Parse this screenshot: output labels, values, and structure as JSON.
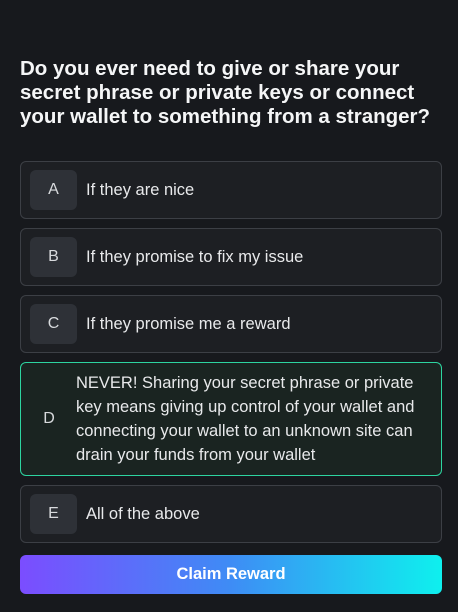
{
  "question": "Do you ever need to give or share your secret phrase or private keys or connect your wallet to something from a stranger?",
  "options": [
    {
      "letter": "A",
      "text": "If they are nice"
    },
    {
      "letter": "B",
      "text": "If they promise to fix my issue"
    },
    {
      "letter": "C",
      "text": "If they promise me a reward"
    },
    {
      "letter": "D",
      "text": "NEVER! Sharing your secret phrase or private key means giving up control of your wallet and connecting your wallet to an unknown site can drain your funds from your wallet"
    },
    {
      "letter": "E",
      "text": "All of the above"
    }
  ],
  "selected_option": "D",
  "claim_button": "Claim Reward",
  "colors": {
    "background": "#17191d",
    "selected_border": "#2dd4a0",
    "button_gradient_start": "#7b4dff",
    "button_gradient_end": "#0ef0ee"
  }
}
